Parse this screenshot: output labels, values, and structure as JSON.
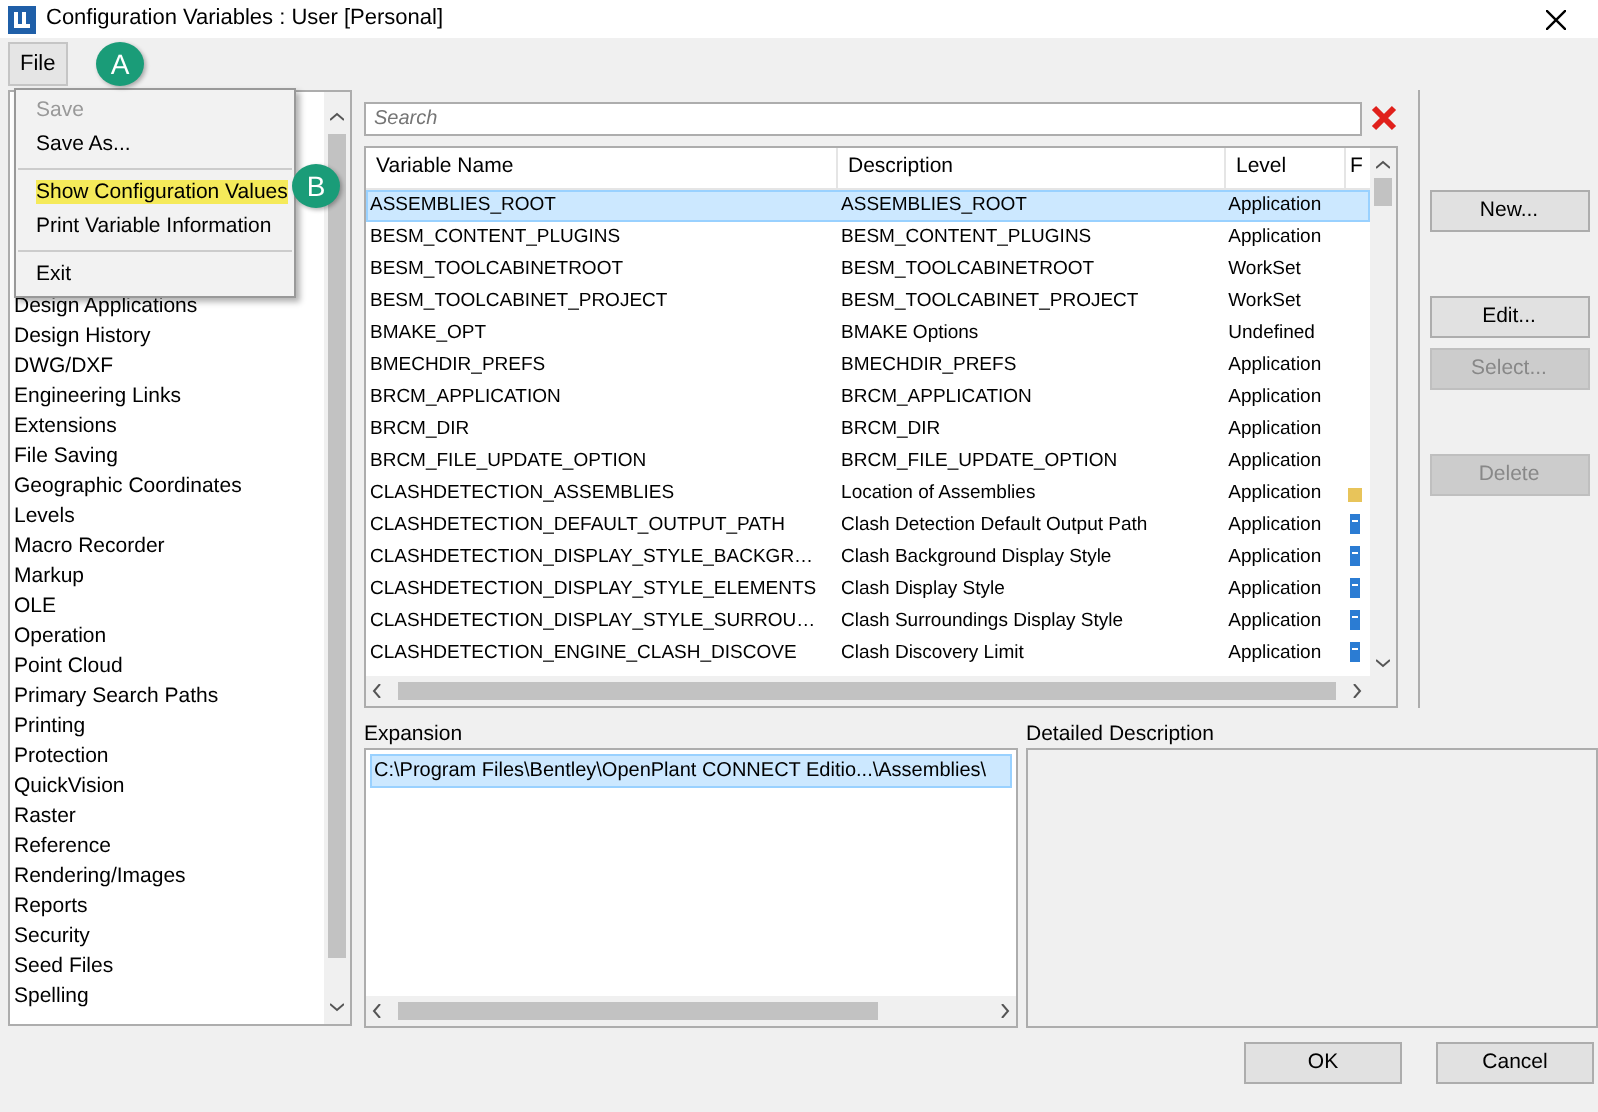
{
  "window": {
    "title": "Configuration Variables : User [Personal]"
  },
  "menu_bar": [
    {
      "label": "File",
      "open": true
    }
  ],
  "file_menu": [
    {
      "kind": "item",
      "label": "Save",
      "disabled": true,
      "highlighted": false
    },
    {
      "kind": "item",
      "label": "Save As...",
      "disabled": false,
      "highlighted": false
    },
    {
      "kind": "separator"
    },
    {
      "kind": "item",
      "label": "Show Configuration Values",
      "disabled": false,
      "highlighted": true
    },
    {
      "kind": "item",
      "label": "Print Variable Information",
      "disabled": false,
      "highlighted": false
    },
    {
      "kind": "separator"
    },
    {
      "kind": "item",
      "label": "Exit",
      "disabled": false,
      "highlighted": false
    }
  ],
  "callouts": [
    {
      "label": "A"
    },
    {
      "label": "B"
    }
  ],
  "categories": [
    "Design Applications",
    "Design History",
    "DWG/DXF",
    "Engineering Links",
    "Extensions",
    "File Saving",
    "Geographic Coordinates",
    "Levels",
    "Macro Recorder",
    "Markup",
    "OLE",
    "Operation",
    "Point Cloud",
    "Primary Search Paths",
    "Printing",
    "Protection",
    "QuickVision",
    "Raster",
    "Reference",
    "Rendering/Images",
    "Reports",
    "Security",
    "Seed Files",
    "Spelling"
  ],
  "search": {
    "placeholder": "Search"
  },
  "table": {
    "columns": [
      "Variable Name",
      "Description",
      "Level",
      "F"
    ],
    "rows": [
      {
        "cells": [
          "ASSEMBLIES_ROOT",
          "ASSEMBLIES_ROOT",
          "Application"
        ],
        "selected": true,
        "kind": "plain"
      },
      {
        "cells": [
          "BESM_CONTENT_PLUGINS",
          "BESM_CONTENT_PLUGINS",
          "Application"
        ],
        "selected": false,
        "kind": "plain"
      },
      {
        "cells": [
          "BESM_TOOLCABINETROOT",
          "BESM_TOOLCABINETROOT",
          "WorkSet"
        ],
        "selected": false,
        "kind": "plain"
      },
      {
        "cells": [
          "BESM_TOOLCABINET_PROJECT",
          "BESM_TOOLCABINET_PROJECT",
          "WorkSet"
        ],
        "selected": false,
        "kind": "plain"
      },
      {
        "cells": [
          "BMAKE_OPT",
          "BMAKE Options",
          "Undefined"
        ],
        "selected": false,
        "kind": "plain"
      },
      {
        "cells": [
          "BMECHDIR_PREFS",
          "BMECHDIR_PREFS",
          "Application"
        ],
        "selected": false,
        "kind": "plain"
      },
      {
        "cells": [
          "BRCM_APPLICATION",
          "BRCM_APPLICATION",
          "Application"
        ],
        "selected": false,
        "kind": "plain"
      },
      {
        "cells": [
          "BRCM_DIR",
          "BRCM_DIR",
          "Application"
        ],
        "selected": false,
        "kind": "plain"
      },
      {
        "cells": [
          "BRCM_FILE_UPDATE_OPTION",
          "BRCM_FILE_UPDATE_OPTION",
          "Application"
        ],
        "selected": false,
        "kind": "plain"
      },
      {
        "cells": [
          "CLASHDETECTION_ASSEMBLIES",
          "Location of Assemblies",
          "Application"
        ],
        "selected": false,
        "kind": "folder"
      },
      {
        "cells": [
          "CLASHDETECTION_DEFAULT_OUTPUT_PATH",
          "Clash Detection Default Output Path",
          "Application"
        ],
        "selected": false,
        "kind": "file"
      },
      {
        "cells": [
          "CLASHDETECTION_DISPLAY_STYLE_BACKGR…",
          "Clash Background Display Style",
          "Application"
        ],
        "selected": false,
        "kind": "file"
      },
      {
        "cells": [
          "CLASHDETECTION_DISPLAY_STYLE_ELEMENTS",
          "Clash Display Style",
          "Application"
        ],
        "selected": false,
        "kind": "file"
      },
      {
        "cells": [
          "CLASHDETECTION_DISPLAY_STYLE_SURROU…",
          "Clash Surroundings Display Style",
          "Application"
        ],
        "selected": false,
        "kind": "file"
      },
      {
        "cells": [
          "CLASHDETECTION_ENGINE_CLASH_DISCOVE",
          "Clash Discovery Limit",
          "Application"
        ],
        "selected": false,
        "kind": "file"
      }
    ]
  },
  "side_buttons": [
    {
      "kind": "button",
      "label": "New...",
      "disabled": false
    },
    {
      "kind": "spacer"
    },
    {
      "kind": "button",
      "label": "Edit...",
      "disabled": false
    },
    {
      "kind": "button",
      "label": "Select...",
      "disabled": true
    },
    {
      "kind": "spacer"
    },
    {
      "kind": "button",
      "label": "Delete",
      "disabled": true
    }
  ],
  "expansion": {
    "label": "Expansion",
    "rows": [
      {
        "text": "C:\\Program Files\\Bentley\\OpenPlant CONNECT Editio...\\Assemblies\\",
        "selected": true
      }
    ]
  },
  "detailed_description": {
    "label": "Detailed Description"
  },
  "dialog_buttons": [
    {
      "label": "OK"
    },
    {
      "label": "Cancel"
    }
  ]
}
